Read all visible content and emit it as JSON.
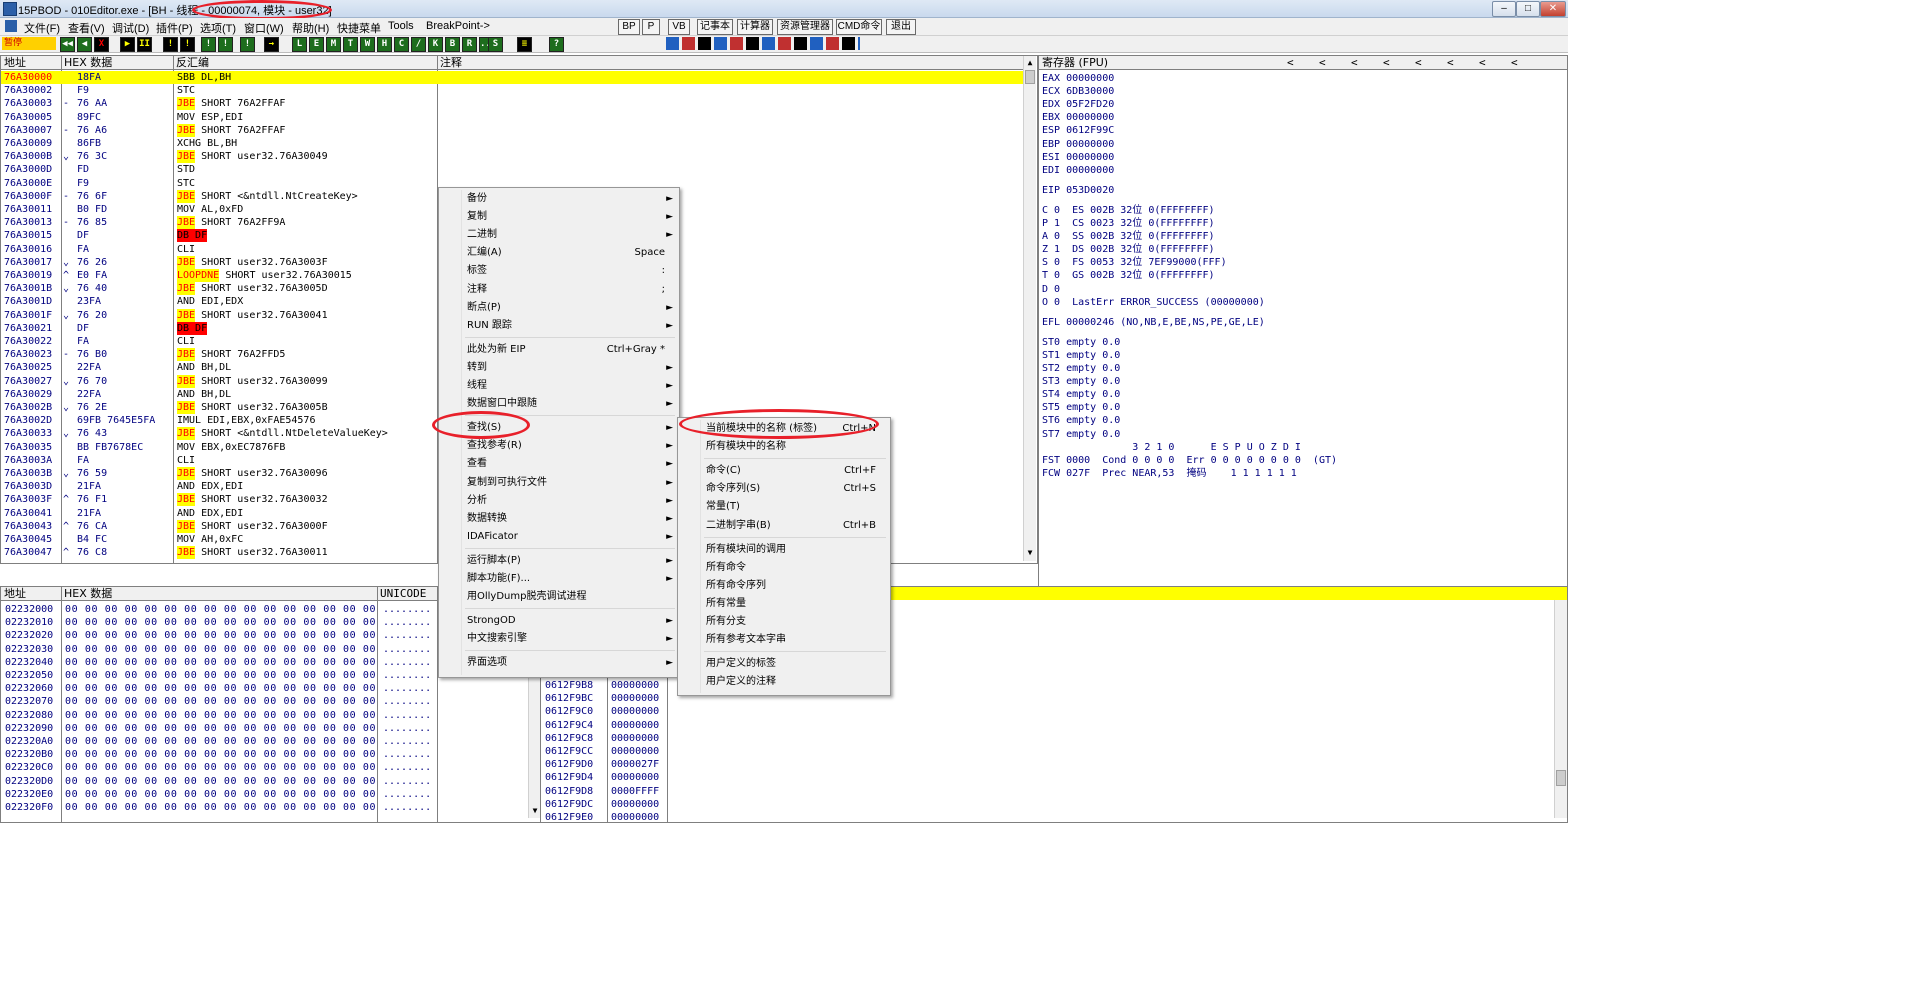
{
  "window": {
    "title": "15PBOD - 010Editor.exe - [BH - 线程 - 00000074, 模块 - user32]"
  },
  "menubar": {
    "items": [
      "文件(F)",
      "查看(V)",
      "调试(D)",
      "插件(P)",
      "选项(T)",
      "窗口(W)",
      "帮助(H)",
      "快捷菜单",
      "Tools",
      "BreakPoint->"
    ],
    "buttons": [
      "BP",
      "P",
      "VB",
      "记事本",
      "计算器",
      "资源管理器",
      "CMD命令",
      "退出"
    ]
  },
  "toolbar": {
    "status": "暂停",
    "icons": [
      "◀◀",
      "◀",
      "X",
      "▶",
      "II",
      "!",
      "!",
      "!",
      "!",
      "!",
      "→",
      "L",
      "E",
      "M",
      "T",
      "W",
      "H",
      "C",
      "/",
      "K",
      "B",
      "R",
      "...",
      "S",
      "≡",
      "?"
    ]
  },
  "cpu": {
    "headers": {
      "addr": "地址",
      "hex": "HEX 数据",
      "disasm": "反汇编",
      "comment": "注释"
    },
    "rows": [
      [
        "76A30000",
        "",
        "18FA",
        "SBB DL,BH"
      ],
      [
        "76A30002",
        "",
        "F9",
        "STC"
      ],
      [
        "76A30003",
        "-",
        "76 AA",
        "JBE| SHORT 76A2FFAF"
      ],
      [
        "76A30005",
        "",
        "89FC",
        "MOV ESP,EDI"
      ],
      [
        "76A30007",
        "-",
        "76 A6",
        "JBE| SHORT 76A2FFAF"
      ],
      [
        "76A30009",
        "",
        "86FB",
        "XCHG BL,BH"
      ],
      [
        "76A3000B",
        "⌄",
        "76 3C",
        "JBE| SHORT user32.76A30049"
      ],
      [
        "76A3000D",
        "",
        "FD",
        "STD"
      ],
      [
        "76A3000E",
        "",
        "F9",
        "STC"
      ],
      [
        "76A3000F",
        "-",
        "76 6F",
        "JBE| SHORT <&ntdll.NtCreateKey>"
      ],
      [
        "76A30011",
        "",
        "B0 FD",
        "MOV AL,0xFD"
      ],
      [
        "76A30013",
        "-",
        "76 85",
        "JBE| SHORT 76A2FF9A"
      ],
      [
        "76A30015",
        "",
        "DF",
        "DB DF"
      ],
      [
        "76A30016",
        "",
        "FA",
        "CLI"
      ],
      [
        "76A30017",
        "⌄",
        "76 26",
        "JBE| SHORT user32.76A3003F"
      ],
      [
        "76A30019",
        "^",
        "E0 FA",
        "LOOPDNE| SHORT user32.76A30015"
      ],
      [
        "76A3001B",
        "⌄",
        "76 40",
        "JBE| SHORT user32.76A3005D"
      ],
      [
        "76A3001D",
        "",
        "23FA",
        "AND EDI,EDX"
      ],
      [
        "76A3001F",
        "⌄",
        "76 20",
        "JBE| SHORT user32.76A30041"
      ],
      [
        "76A30021",
        "",
        "DF",
        "DB DF"
      ],
      [
        "76A30022",
        "",
        "FA",
        "CLI"
      ],
      [
        "76A30023",
        "-",
        "76 B0",
        "JBE| SHORT 76A2FFD5"
      ],
      [
        "76A30025",
        "",
        "22FA",
        "AND BH,DL"
      ],
      [
        "76A30027",
        "⌄",
        "76 70",
        "JBE| SHORT user32.76A30099"
      ],
      [
        "76A30029",
        "",
        "22FA",
        "AND BH,DL"
      ],
      [
        "76A3002B",
        "⌄",
        "76 2E",
        "JBE| SHORT user32.76A3005B"
      ],
      [
        "76A3002D",
        "",
        "69FB 7645E5FA",
        "IMUL EDI,EBX,0xFAE54576"
      ],
      [
        "76A30033",
        "⌄",
        "76 43",
        "JBE| SHORT <&ntdll.NtDeleteValueKey>"
      ],
      [
        "76A30035",
        "",
        "BB FB7678EC",
        "MOV EBX,0xEC7876FB"
      ],
      [
        "76A3003A",
        "",
        "FA",
        "CLI"
      ],
      [
        "76A3003B",
        "⌄",
        "76 59",
        "JBE| SHORT user32.76A30096"
      ],
      [
        "76A3003D",
        "",
        "21FA",
        "AND EDX,EDI"
      ],
      [
        "76A3003F",
        "^",
        "76 F1",
        "JBE| SHORT user32.76A30032"
      ],
      [
        "76A30041",
        "",
        "21FA",
        "AND EDX,EDI"
      ],
      [
        "76A30043",
        "^",
        "76 CA",
        "JBE| SHORT user32.76A3000F"
      ],
      [
        "76A30045",
        "",
        "B4 FC",
        "MOV AH,0xFC"
      ],
      [
        "76A30047",
        "^",
        "76 C8",
        "JBE| SHORT user32.76A30011"
      ]
    ]
  },
  "registers": {
    "header": "寄存器 (FPU)",
    "arrows": [
      "<",
      "<",
      "<",
      "<",
      "<",
      "<",
      "<",
      "<"
    ],
    "lines": [
      "EAX 00000000",
      "ECX 6DB30000",
      "EDX 05F2FD20",
      "EBX 00000000",
      "ESP 0612F99C",
      "EBP 00000000",
      "ESI 00000000",
      "EDI 00000000",
      "",
      "EIP 053D0020",
      "",
      "C 0  ES 002B 32位 0(FFFFFFFF)",
      "P 1  CS 0023 32位 0(FFFFFFFF)",
      "A 0  SS 002B 32位 0(FFFFFFFF)",
      "Z 1  DS 002B 32位 0(FFFFFFFF)",
      "S 0  FS 0053 32位 7EF99000(FFF)",
      "T 0  GS 002B 32位 0(FFFFFFFF)",
      "D 0",
      "O 0  LastErr ERROR_SUCCESS (00000000)",
      "",
      "EFL 00000246 (NO,NB,E,BE,NS,PE,GE,LE)",
      "",
      "ST0 empty 0.0",
      "ST1 empty 0.0",
      "ST2 empty 0.0",
      "ST3 empty 0.0",
      "ST4 empty 0.0",
      "ST5 empty 0.0",
      "ST6 empty 0.0",
      "ST7 empty 0.0",
      "               3 2 1 0      E S P U O Z D I",
      "FST 0000  Cond 0 0 0 0  Err 0 0 0 0 0 0 0 0  (GT)",
      "FCW 027F  Prec NEAR,53  掩码    1 1 1 1 1 1"
    ]
  },
  "dump": {
    "headers": {
      "addr": "地址",
      "hex": "HEX 数据",
      "unicode": "UNICODE"
    },
    "addrs": [
      "02232000",
      "02232010",
      "02232020",
      "02232030",
      "02232040",
      "02232050",
      "02232060",
      "02232070",
      "02232080",
      "02232090",
      "022320A0",
      "022320B0",
      "022320C0",
      "022320D0",
      "022320E0",
      "022320F0"
    ],
    "hex": "00 00 00 00 00 00 00 00 00 00 00 00 00 00 00 00",
    "unicode": "........"
  },
  "stack": {
    "rows": [
      [
        "0612F9B8",
        "00000000"
      ],
      [
        "0612F9BC",
        "00000000"
      ],
      [
        "0612F9C0",
        "00000000"
      ],
      [
        "0612F9C4",
        "00000000"
      ],
      [
        "0612F9C8",
        "00000000"
      ],
      [
        "0612F9CC",
        "00000000"
      ],
      [
        "0612F9D0",
        "0000027F"
      ],
      [
        "0612F9D4",
        "00000000"
      ],
      [
        "0612F9D8",
        "0000FFFF"
      ],
      [
        "0612F9DC",
        "00000000"
      ],
      [
        "0612F9E0",
        "00000000"
      ]
    ]
  },
  "context_menu": {
    "items": [
      {
        "label": "备份",
        "shortcut": "",
        "arrow": true
      },
      {
        "label": "复制",
        "shortcut": "",
        "arrow": true
      },
      {
        "label": "二进制",
        "shortcut": "",
        "arrow": true
      },
      {
        "label": "汇编(A)",
        "shortcut": "Space",
        "arrow": false
      },
      {
        "label": "标签",
        "shortcut": ":",
        "arrow": false
      },
      {
        "label": "注释",
        "shortcut": ";",
        "arrow": false
      },
      {
        "label": "断点(P)",
        "shortcut": "",
        "arrow": true
      },
      {
        "label": "RUN 跟踪",
        "shortcut": "",
        "arrow": true
      },
      {
        "sep": true
      },
      {
        "label": "此处为新 EIP",
        "shortcut": "Ctrl+Gray *",
        "arrow": false
      },
      {
        "label": "转到",
        "shortcut": "",
        "arrow": true
      },
      {
        "label": "线程",
        "shortcut": "",
        "arrow": true
      },
      {
        "label": "数据窗口中跟随",
        "shortcut": "",
        "arrow": true
      },
      {
        "sep": true
      },
      {
        "label": "查找(S)",
        "shortcut": "",
        "arrow": true,
        "active": true
      },
      {
        "label": "查找参考(R)",
        "shortcut": "",
        "arrow": true
      },
      {
        "label": "查看",
        "shortcut": "",
        "arrow": true
      },
      {
        "label": "复制到可执行文件",
        "shortcut": "",
        "arrow": true
      },
      {
        "label": "分析",
        "shortcut": "",
        "arrow": true
      },
      {
        "label": "数据转换",
        "shortcut": "",
        "arrow": true
      },
      {
        "label": "IDAFicator",
        "shortcut": "",
        "arrow": true
      },
      {
        "sep": true
      },
      {
        "label": "运行脚本(P)",
        "shortcut": "",
        "arrow": true
      },
      {
        "label": "脚本功能(F)...",
        "shortcut": "",
        "arrow": true
      },
      {
        "label": "用OllyDump脱壳调试进程",
        "shortcut": "",
        "arrow": false
      },
      {
        "sep": true
      },
      {
        "label": "StrongOD",
        "shortcut": "",
        "arrow": true
      },
      {
        "label": "中文搜索引擎",
        "shortcut": "",
        "arrow": true
      },
      {
        "sep": true
      },
      {
        "label": "界面选项",
        "shortcut": "",
        "arrow": true
      }
    ]
  },
  "submenu": {
    "items": [
      {
        "label": "当前模块中的名称 (标签)",
        "shortcut": "Ctrl+N",
        "active": true
      },
      {
        "label": "所有模块中的名称",
        "shortcut": ""
      },
      {
        "sep": true
      },
      {
        "label": "命令(C)",
        "shortcut": "Ctrl+F"
      },
      {
        "label": "命令序列(S)",
        "shortcut": "Ctrl+S"
      },
      {
        "label": "常量(T)",
        "shortcut": ""
      },
      {
        "label": "二进制字串(B)",
        "shortcut": "Ctrl+B"
      },
      {
        "sep": true
      },
      {
        "label": "所有模块间的调用",
        "shortcut": ""
      },
      {
        "label": "所有命令",
        "shortcut": ""
      },
      {
        "label": "所有命令序列",
        "shortcut": ""
      },
      {
        "label": "所有常量",
        "shortcut": ""
      },
      {
        "label": "所有分支",
        "shortcut": ""
      },
      {
        "label": "所有参考文本字串",
        "shortcut": ""
      },
      {
        "sep": true
      },
      {
        "label": "用户定义的标签",
        "shortcut": ""
      },
      {
        "label": "用户定义的注释",
        "shortcut": ""
      }
    ]
  },
  "colors": {
    "highlight": "#ffff00",
    "jump": "#ff0000",
    "text": "#000080",
    "annotation": "#e8202a"
  }
}
